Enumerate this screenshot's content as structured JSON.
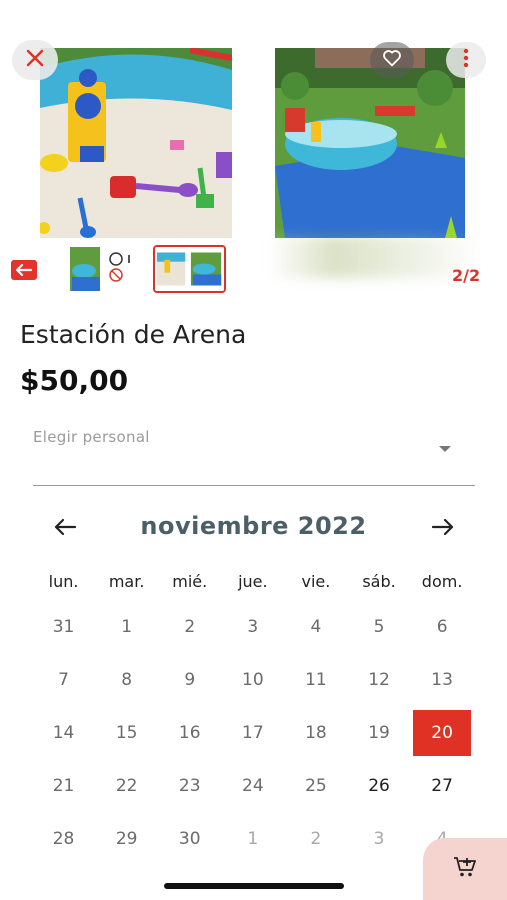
{
  "gallery": {
    "counter": "2/2",
    "photos": [
      "sandbox-with-toys-photo",
      "pool-on-lawn-photo"
    ],
    "thumbnails": [
      "product-thumbnail-1",
      "product-thumbnail-2"
    ],
    "icons": {
      "close": "close-icon",
      "favorite": "heart-icon",
      "more": "more-vert-icon",
      "back": "arrow-left-icon"
    }
  },
  "product": {
    "title": "Estación de Arena",
    "price": "$50,00"
  },
  "staff_select": {
    "label": "Elegir personal"
  },
  "calendar": {
    "month_label": "noviembre 2022",
    "weekdays": [
      "lun.",
      "mar.",
      "mié.",
      "jue.",
      "vie.",
      "sáb.",
      "dom."
    ],
    "weeks": [
      [
        "31",
        "1",
        "2",
        "3",
        "4",
        "5",
        "6"
      ],
      [
        "7",
        "8",
        "9",
        "10",
        "11",
        "12",
        "13"
      ],
      [
        "14",
        "15",
        "16",
        "17",
        "18",
        "19",
        "20"
      ],
      [
        "21",
        "22",
        "23",
        "24",
        "25",
        "26",
        "27"
      ],
      [
        "28",
        "29",
        "30",
        "1",
        "2",
        "3",
        "4"
      ]
    ],
    "selected_day": "20"
  },
  "colors": {
    "accent": "#e03224",
    "month_title": "#4a5f67",
    "cart_fab_bg": "#f5d3ce"
  }
}
